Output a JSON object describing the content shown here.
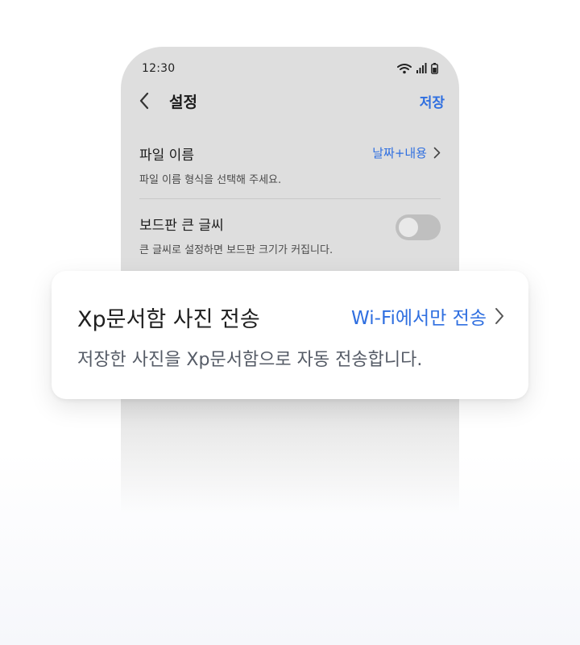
{
  "status_bar": {
    "time": "12:30",
    "icons": [
      "wifi-icon",
      "signal-icon",
      "battery-icon"
    ]
  },
  "header": {
    "back_icon": "chevron-left-icon",
    "title": "설정",
    "save_label": "저장"
  },
  "settings": {
    "file_name": {
      "title": "파일 이름",
      "value": "날짜+내용",
      "description": "파일 이름 형식을 선택해 주세요."
    },
    "board_big_font": {
      "title": "보드판 큰 글씨",
      "description": "큰 글씨로 설정하면 보드판 크기가 커집니다.",
      "enabled": false
    }
  },
  "card": {
    "title": "Xp문서함 사진 전송",
    "value": "Wi-Fi에서만 전송",
    "description": "저장한 사진을 Xp문서함으로 자동 전송합니다."
  },
  "colors": {
    "accent": "#2f6fe0",
    "phone_bg": "#dedede",
    "toggle_off": "#bfbfbf"
  }
}
